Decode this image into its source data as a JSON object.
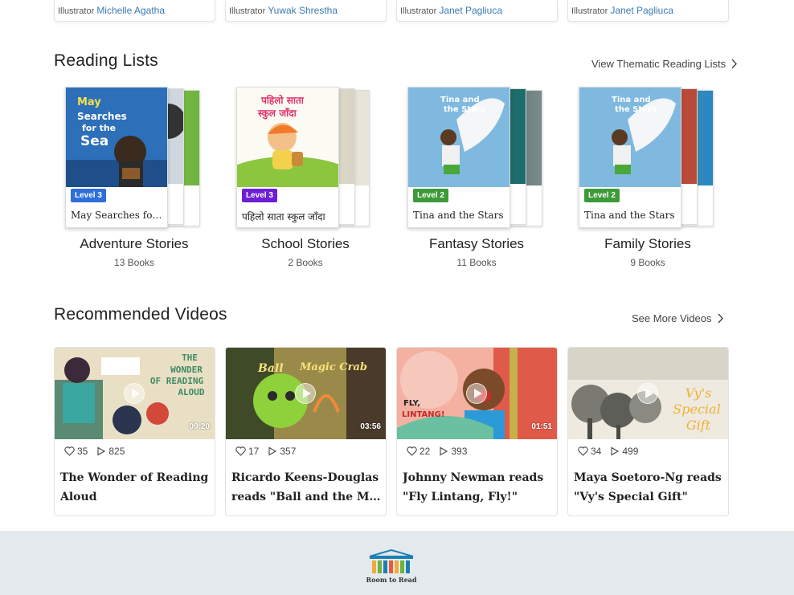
{
  "top_cards": [
    {
      "prefix": "Illustrator",
      "name": "Michelle Agatha"
    },
    {
      "prefix": "Illustrator",
      "name": "Yuwak Shrestha"
    },
    {
      "prefix": "Illustrator",
      "name": "Janet Pagliuca"
    },
    {
      "prefix": "Illustrator",
      "name": "Janet Pagliuca"
    }
  ],
  "reading_lists": {
    "title": "Reading Lists",
    "link": "View Thematic Reading Lists",
    "items": [
      {
        "name": "Adventure Stories",
        "count": "13 Books",
        "level": "Level 3",
        "level_color": "#2f6fdc",
        "book_title": "May Searches for t...",
        "cover_text": "May Searches for the Sea"
      },
      {
        "name": "School Stories",
        "count": "2 Books",
        "level": "Level 3",
        "level_color": "#6d1fd6",
        "book_title": "पहिलो साता स्कुल जाँदा",
        "cover_text": "पहिलो साता स्कुल जाँदा"
      },
      {
        "name": "Fantasy Stories",
        "count": "11 Books",
        "level": "Level 2",
        "level_color": "#3d9a38",
        "book_title": "Tina and the Stars",
        "cover_text": "Tina and the Stars"
      },
      {
        "name": "Family Stories",
        "count": "9 Books",
        "level": "Level 2",
        "level_color": "#3d9a38",
        "book_title": "Tina and the Stars",
        "cover_text": "Tina and the Stars"
      }
    ]
  },
  "videos": {
    "title": "Recommended Videos",
    "link": "See More Videos",
    "items": [
      {
        "likes": "35",
        "views": "825",
        "duration": "09:20",
        "title_line1": "The Wonder of Reading",
        "title_line2": "Aloud",
        "thumb_text": "THE WONDER OF READING ALOUD"
      },
      {
        "likes": "17",
        "views": "357",
        "duration": "03:56",
        "title_line1": "Ricardo Keens-Douglas",
        "title_line2": "reads \"Ball and the Magi...",
        "thumb_text": "Ball and the Magic Crab"
      },
      {
        "likes": "22",
        "views": "393",
        "duration": "01:51",
        "title_line1": "Johnny Newman reads",
        "title_line2": "\"Fly Lintang, Fly!\"",
        "thumb_text": "FLY, LINTANG!"
      },
      {
        "likes": "34",
        "views": "499",
        "duration": "",
        "title_line1": "Maya Soetoro-Ng reads",
        "title_line2": "\"Vy's Special Gift\"",
        "thumb_text": "Vy's Special Gift"
      }
    ]
  },
  "footer": {
    "logo_text": "Room to Read"
  },
  "colors": {
    "accent_link": "#3a7ab5",
    "footer_bg": "#e3e9ec"
  }
}
